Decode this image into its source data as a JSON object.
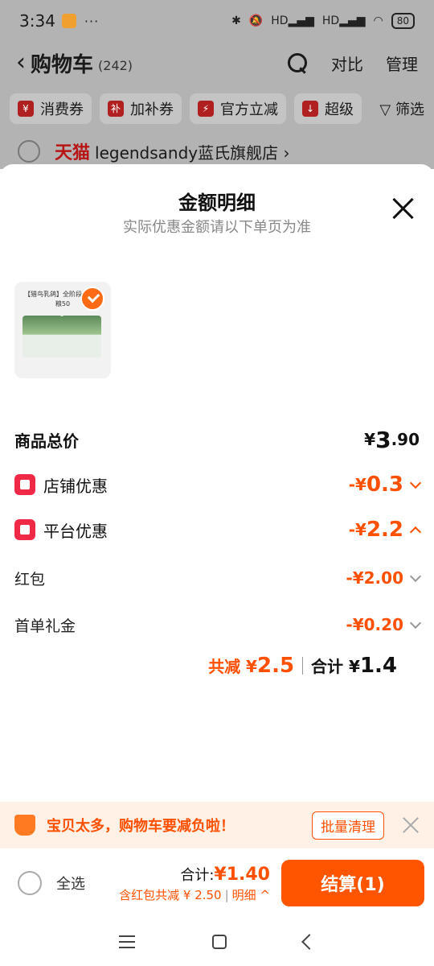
{
  "status_bar": {
    "time": "3:34",
    "dots": "···",
    "hd1": "HD",
    "hd2": "HD",
    "battery": "80"
  },
  "header": {
    "title": "购物车",
    "count": "(242)",
    "compare": "对比",
    "manage": "管理"
  },
  "chips": [
    "消费券",
    "加补券",
    "官方立减",
    "超级"
  ],
  "chip_icons": [
    "¥",
    "补",
    "⚡",
    "↓"
  ],
  "filter_label": "筛选",
  "store": {
    "brand": "天猫",
    "name": "legendsandy蓝氏旗舰店 ›"
  },
  "sheet": {
    "title": "金额明细",
    "subtitle": "实际优惠金额请以下单页为准",
    "product_label": "【猎鸟乳鸽】全阶段全价猫粮50",
    "rows": {
      "total": {
        "label": "商品总价",
        "currency": "¥",
        "int": "3",
        "dec": ".90"
      },
      "store_discount": {
        "label": "店铺优惠",
        "prefix": "-¥",
        "amount": "0.3"
      },
      "platform_discount": {
        "label": "平台优惠",
        "prefix": "-¥",
        "amount": "2.2"
      },
      "red_packet": {
        "label": "红包",
        "prefix": "-¥",
        "amount": "2.00"
      },
      "first_order_gift": {
        "label": "首单礼金",
        "prefix": "-¥",
        "amount": "0.20"
      }
    },
    "summary": {
      "discount_label": "共减 ¥",
      "discount_amount": "2.5",
      "total_label": "合计 ¥",
      "total_amount": "1.4"
    }
  },
  "notice": {
    "text": "宝贝太多，购物车要减负啦！",
    "button": "批量清理"
  },
  "checkout": {
    "select_all": "全选",
    "total_label": "合计:",
    "total_amount": "¥1.40",
    "discount_text": "含红包共减 ¥ 2.50",
    "detail_link": "明细 ^",
    "settle_button": "结算(1)"
  },
  "colors": {
    "accent": "#ff5000",
    "settle_button": "#ff5500",
    "overlay": "#b3b3b3",
    "tmall_red": "#b81414"
  }
}
